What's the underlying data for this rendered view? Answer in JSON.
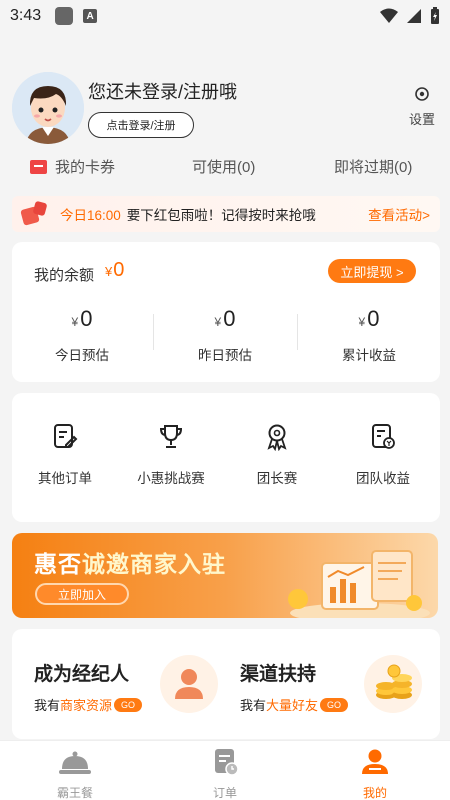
{
  "status_bar": {
    "time": "3:43",
    "badge_letter": "A"
  },
  "profile": {
    "title": "您还未登录/注册哦",
    "login_button": "点击登录/注册",
    "settings_label": "设置"
  },
  "coupons": {
    "mine": "我的卡券",
    "usable": "可使用(0)",
    "expiring": "即将过期(0)"
  },
  "promo": {
    "time": "今日16:00",
    "message": "要下红包雨啦！记得按时来抢哦",
    "link": "查看活动>"
  },
  "balance": {
    "label": "我的余额",
    "currency": "¥",
    "value": "0",
    "withdraw": "立即提现 >",
    "stats": [
      {
        "value": "0",
        "label": "今日预估"
      },
      {
        "value": "0",
        "label": "昨日预估"
      },
      {
        "value": "0",
        "label": "累计收益"
      }
    ]
  },
  "menu": [
    {
      "label": "其他订单",
      "icon": "order-edit-icon"
    },
    {
      "label": "小惠挑战赛",
      "icon": "trophy-icon"
    },
    {
      "label": "团长赛",
      "icon": "medal-icon"
    },
    {
      "label": "团队收益",
      "icon": "earnings-doc-icon"
    }
  ],
  "merchant": {
    "title_prefix": "惠否",
    "title_highlight": "诚邀商家入驻",
    "button": "立即加入"
  },
  "broker": [
    {
      "title": "成为经纪人",
      "prefix": "我有",
      "highlight": "商家资源",
      "go": "GO"
    },
    {
      "title": "渠道扶持",
      "prefix": "我有",
      "highlight": "大量好友",
      "go": "GO"
    }
  ],
  "tabbar": [
    {
      "label": "霸王餐",
      "icon": "dish-cover-icon",
      "active": false
    },
    {
      "label": "订单",
      "icon": "order-icon",
      "active": false
    },
    {
      "label": "我的",
      "icon": "user-icon",
      "active": true
    }
  ],
  "colors": {
    "accent": "#ff6a00",
    "button": "#ff7a12"
  }
}
